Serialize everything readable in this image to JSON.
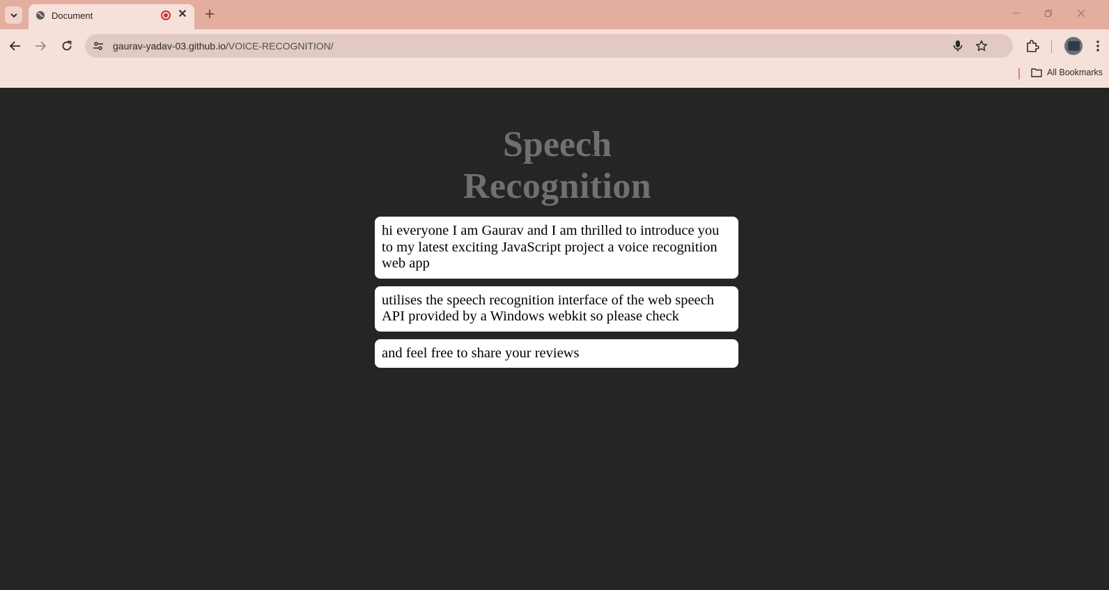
{
  "browser": {
    "tab": {
      "title": "Document"
    },
    "address_bar": {
      "host": "gaurav-yadav-03.github.io",
      "path": "/VOICE-RECOGNITION/"
    },
    "bookmarks_bar": {
      "all_bookmarks_label": "All Bookmarks"
    },
    "colors": {
      "tab_strip": "#e3ada0",
      "toolbar": "#f6e0da",
      "omnibox": "#e2c9c3",
      "record_indicator": "#c9342d"
    },
    "icons": [
      "tab-search-chevron-icon",
      "globe-icon",
      "record-icon",
      "close-icon",
      "plus-icon",
      "back-icon",
      "forward-icon",
      "reload-icon",
      "site-info-icon",
      "microphone-icon",
      "star-icon",
      "extensions-icon",
      "profile-avatar",
      "more-menu-icon",
      "folder-icon",
      "minimize-icon",
      "restore-icon",
      "window-close-icon"
    ]
  },
  "page": {
    "heading": {
      "line1": "Speech",
      "line2": "Recognition"
    },
    "transcripts": [
      "hi everyone I am Gaurav and I am thrilled to introduce you to my latest exciting JavaScript project a voice recognition web app",
      "utilises the speech recognition interface of the web speech API provided by a Windows webkit so please check",
      "and feel free to share your reviews"
    ],
    "colors": {
      "background": "#252525",
      "heading": "#707070",
      "card": "#ffffff"
    }
  }
}
